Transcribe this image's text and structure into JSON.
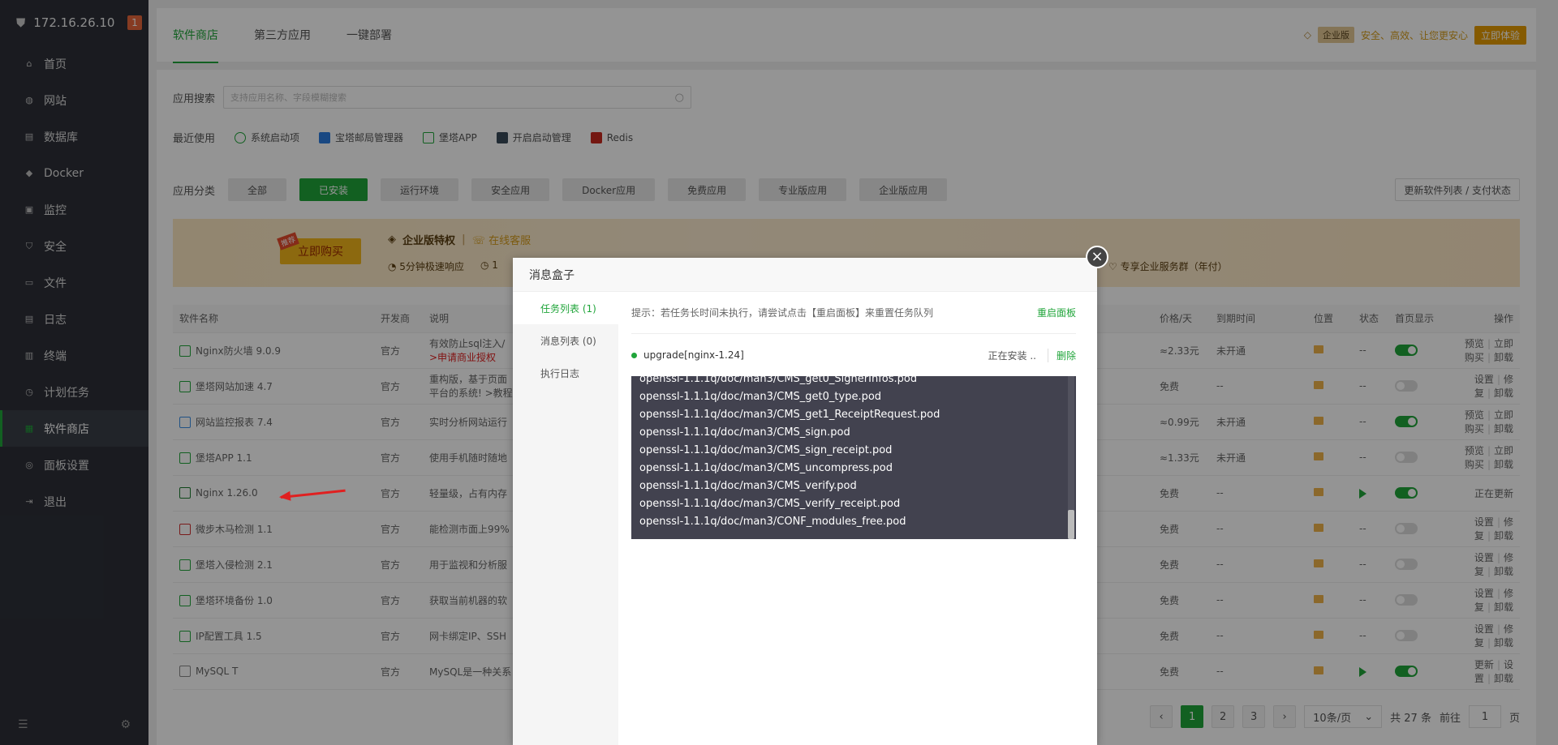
{
  "sidebar": {
    "ip": "172.16.26.10",
    "badge": "1",
    "items": [
      {
        "label": "首页",
        "icon": "home-icon"
      },
      {
        "label": "网站",
        "icon": "globe-icon"
      },
      {
        "label": "数据库",
        "icon": "database-icon"
      },
      {
        "label": "Docker",
        "icon": "docker-icon"
      },
      {
        "label": "监控",
        "icon": "monitor-icon"
      },
      {
        "label": "安全",
        "icon": "shield-icon"
      },
      {
        "label": "文件",
        "icon": "folder-icon"
      },
      {
        "label": "日志",
        "icon": "log-icon"
      },
      {
        "label": "终端",
        "icon": "terminal-icon"
      },
      {
        "label": "计划任务",
        "icon": "clock-icon"
      },
      {
        "label": "软件商店",
        "icon": "grid-icon"
      },
      {
        "label": "面板设置",
        "icon": "gear-icon"
      },
      {
        "label": "退出",
        "icon": "exit-icon"
      }
    ],
    "active_index": 10
  },
  "tabs": {
    "items": [
      "软件商店",
      "第三方应用",
      "一键部署"
    ],
    "active_index": 0
  },
  "promo": {
    "badge": "企业版",
    "slogan": "安全、高效、让您更安心",
    "cta": "立即体验"
  },
  "search": {
    "label": "应用搜索",
    "placeholder": "支持应用名称、字段模糊搜索"
  },
  "recent": {
    "label": "最近使用",
    "items": [
      "系统启动项",
      "宝塔邮局管理器",
      "堡塔APP",
      "开启启动管理",
      "Redis"
    ]
  },
  "categories": {
    "label": "应用分类",
    "items": [
      "全部",
      "已安装",
      "运行环境",
      "安全应用",
      "Docker应用",
      "免费应用",
      "专业版应用",
      "企业版应用"
    ],
    "active_index": 1,
    "refresh": "更新软件列表 / 支付状态"
  },
  "banner": {
    "tag": "推荐",
    "buy": "立即购买",
    "privilege": "企业版特权",
    "service": "在线客服",
    "f1": "5分钟极速响应",
    "f2": "1",
    "group": "专享企业服务群（年付）"
  },
  "table": {
    "headers": [
      "软件名称",
      "开发商",
      "说明",
      "价格/天",
      "到期时间",
      "位置",
      "状态",
      "首页显示",
      "操作"
    ],
    "rows": [
      {
        "name": "Nginx防火墙 9.0.9",
        "dev": "官方",
        "desc": "有效防止sql注入/",
        "desc2": ">申请商业授权",
        "price": "≈2.33元",
        "price_red": true,
        "expire": "未开通",
        "status": "--",
        "toggle": true,
        "ops": [
          "预览",
          "立即购买",
          "卸载"
        ],
        "color": "#20a53a"
      },
      {
        "name": "堡塔网站加速 4.7",
        "dev": "官方",
        "desc": "重构版，基于页面",
        "desc2": "平台的系统! >教程",
        "price": "免费",
        "price_red": false,
        "expire": "--",
        "status": "--",
        "toggle": false,
        "ops": [
          "设置",
          "修复",
          "卸载"
        ],
        "color": "#20a53a"
      },
      {
        "name": "网站监控报表 7.4",
        "dev": "官方",
        "desc": "实时分析网站运行",
        "desc2": "",
        "price": "≈0.99元",
        "price_red": true,
        "expire": "未开通",
        "status": "--",
        "toggle": true,
        "ops": [
          "预览",
          "立即购买",
          "卸载"
        ],
        "color": "#3a8ee6"
      },
      {
        "name": "堡塔APP 1.1",
        "dev": "官方",
        "desc": "使用手机随时随地",
        "desc2": "",
        "price": "≈1.33元",
        "price_red": true,
        "expire": "未开通",
        "status": "--",
        "toggle": false,
        "ops": [
          "预览",
          "立即购买",
          "卸载"
        ],
        "color": "#20a53a"
      },
      {
        "name": "Nginx 1.26.0",
        "dev": "官方",
        "desc": "轻量级，占有内存",
        "desc2": "",
        "price": "免费",
        "price_red": false,
        "expire": "--",
        "status": "play",
        "toggle": true,
        "ops": [
          "正在更新"
        ],
        "color": "#1a7a2e"
      },
      {
        "name": "微步木马检测 1.1",
        "dev": "官方",
        "desc": "能检测市面上99%",
        "desc2": "",
        "price": "免费",
        "price_red": false,
        "expire": "--",
        "status": "--",
        "toggle": false,
        "ops": [
          "设置",
          "修复",
          "卸载"
        ],
        "color": "#d03030"
      },
      {
        "name": "堡塔入侵检测 2.1",
        "dev": "官方",
        "desc": "用于监视和分析服",
        "desc2": "",
        "price": "免费",
        "price_red": false,
        "expire": "--",
        "status": "--",
        "toggle": false,
        "ops": [
          "设置",
          "修复",
          "卸载"
        ],
        "color": "#20a53a"
      },
      {
        "name": "堡塔环境备份 1.0",
        "dev": "官方",
        "desc": "获取当前机器的软",
        "desc2": "",
        "price": "免费",
        "price_red": false,
        "expire": "--",
        "status": "--",
        "toggle": false,
        "ops": [
          "设置",
          "修复",
          "卸载"
        ],
        "color": "#20a53a"
      },
      {
        "name": "IP配置工具 1.5",
        "dev": "官方",
        "desc": "网卡绑定IP、SSH",
        "desc2": "",
        "price": "免费",
        "price_red": false,
        "expire": "--",
        "status": "--",
        "toggle": false,
        "ops": [
          "设置",
          "修复",
          "卸载"
        ],
        "color": "#20a53a"
      },
      {
        "name": "MySQL T",
        "dev": "官方",
        "desc": "MySQL是一种关系",
        "desc2": "",
        "price": "免费",
        "price_red": false,
        "expire": "--",
        "status": "play",
        "toggle": true,
        "ops": [
          "更新",
          "设置",
          "卸载"
        ],
        "color": "#888"
      }
    ]
  },
  "pager": {
    "pages": [
      "1",
      "2",
      "3"
    ],
    "active": "1",
    "per_page": "10条/页",
    "total": "共 27 条",
    "goto": "前往",
    "goto_value": "1",
    "page_unit": "页"
  },
  "modal": {
    "title": "消息盒子",
    "tabs": [
      "任务列表 (1)",
      "消息列表 (0)",
      "执行日志"
    ],
    "active_tab": 0,
    "hint": "提示：若任务长时间未执行，请尝试点击【重启面板】来重置任务队列",
    "restart": "重启面板",
    "task_name": "upgrade[nginx-1.24]",
    "task_state": "正在安装 ..",
    "task_delete": "删除",
    "log_lines": [
      "openssl-1.1.1q/doc/man3/CMS_get0_SignerInfos.pod",
      "openssl-1.1.1q/doc/man3/CMS_get0_type.pod",
      "openssl-1.1.1q/doc/man3/CMS_get1_ReceiptRequest.pod",
      "openssl-1.1.1q/doc/man3/CMS_sign.pod",
      "openssl-1.1.1q/doc/man3/CMS_sign_receipt.pod",
      "openssl-1.1.1q/doc/man3/CMS_uncompress.pod",
      "openssl-1.1.1q/doc/man3/CMS_verify.pod",
      "openssl-1.1.1q/doc/man3/CMS_verify_receipt.pod",
      "openssl-1.1.1q/doc/man3/CONF_modules_free.pod"
    ]
  },
  "colors": {
    "accent": "#20a53a",
    "sidebar_bg": "#2d3038",
    "log_bg": "#42424f",
    "warn": "#e7673b"
  }
}
